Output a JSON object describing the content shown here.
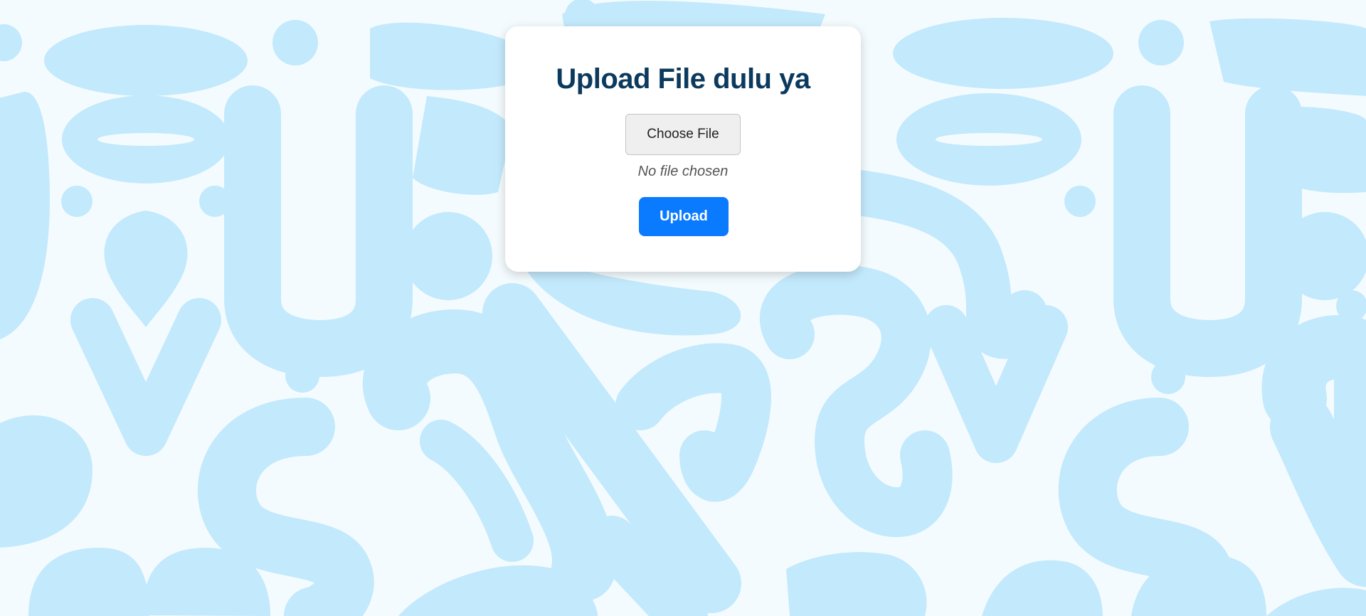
{
  "page": {
    "background_color": "#f4fbfe",
    "pattern_color": "#c3e9fc"
  },
  "card": {
    "title": "Upload File dulu ya",
    "file_input": {
      "button_label": "Choose File",
      "status_text": "No file chosen"
    },
    "upload_button_label": "Upload"
  },
  "colors": {
    "title": "#0b3a5e",
    "accent": "#0a7aff"
  }
}
